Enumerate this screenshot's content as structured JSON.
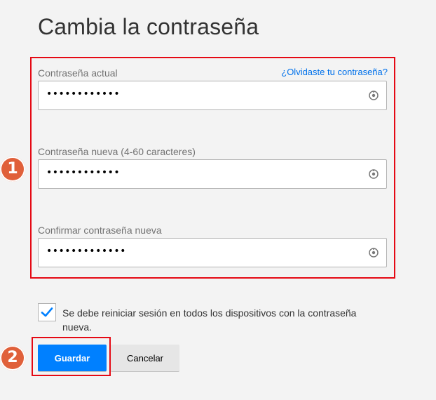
{
  "page": {
    "title": "Cambia la contraseña"
  },
  "form": {
    "current": {
      "label": "Contraseña actual",
      "forgot_link": "¿Olvidaste tu contraseña?",
      "value": "••••••••••••"
    },
    "new": {
      "label": "Contraseña nueva (4-60 caracteres)",
      "value": "••••••••••••"
    },
    "confirm": {
      "label": "Confirmar contraseña nueva",
      "value": "•••••••••••••"
    },
    "signout_checkbox": {
      "checked": true,
      "label": "Se debe reiniciar sesión en todos los dispositivos con la contraseña nueva."
    }
  },
  "actions": {
    "save_label": "Guardar",
    "cancel_label": "Cancelar"
  },
  "annotations": {
    "step1": "1",
    "step2": "2"
  },
  "colors": {
    "background": "#f3f3f3",
    "highlight": "#e50914",
    "link": "#0071eb",
    "primary_button": "#0080ff",
    "checkmark": "#0080ff",
    "badge": "#e0603a"
  },
  "icons": {
    "reveal": "eye-toggle-icon",
    "check": "checkmark-icon"
  }
}
